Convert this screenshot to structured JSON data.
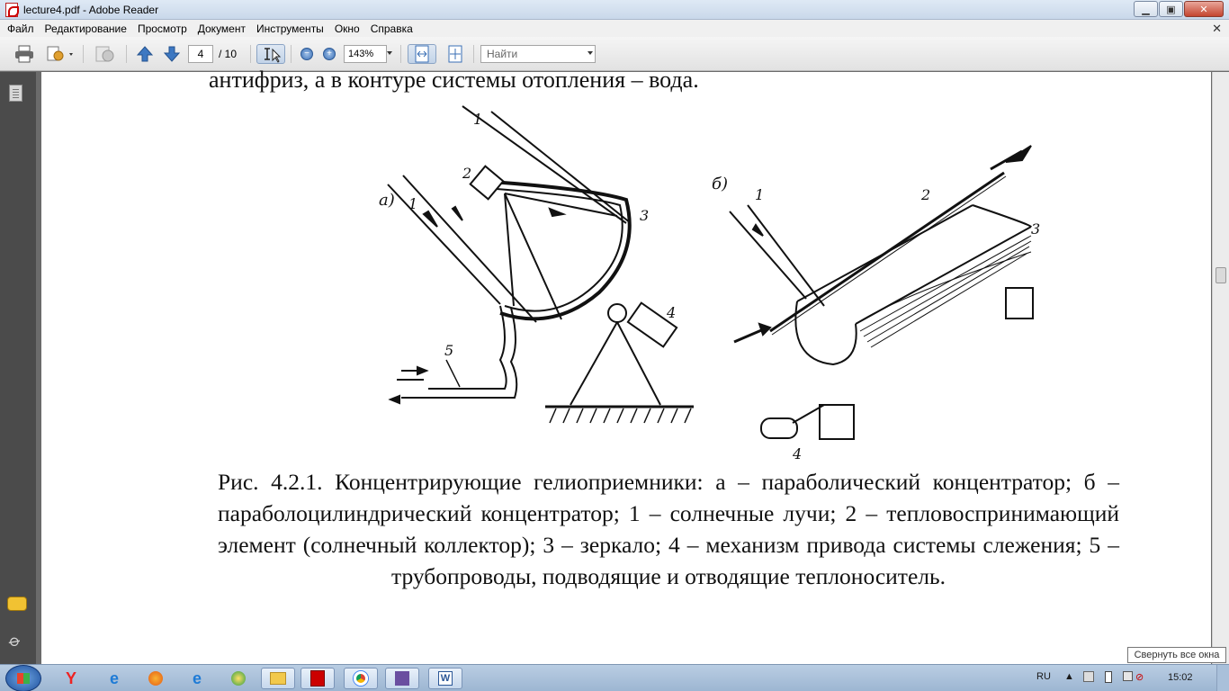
{
  "window": {
    "title": "lecture4.pdf - Adobe Reader",
    "controls": {
      "minimize": "▁",
      "maximize": "▣",
      "close": "✕"
    }
  },
  "menu": {
    "items": [
      "Файл",
      "Редактирование",
      "Просмотр",
      "Документ",
      "Инструменты",
      "Окно",
      "Справка"
    ],
    "close_glyph": "✕"
  },
  "toolbar": {
    "page_current": "4",
    "page_total": "/ 10",
    "zoom": "143%",
    "find_placeholder": "Найти"
  },
  "document": {
    "top_line": "антифриз, а в контуре системы отопления – вода.",
    "caption": "Рис. 4.2.1. Концентрирующие гелиоприемники: а – параболический концентратор; б – параболоцилиндрический концентратор; 1 – солнечные лучи; 2 – тепловоспринимающий элемент (солнечный коллектор); 3 – зеркало; 4 – механизм привода системы слежения; 5 – трубопроводы, подводящие и отводящие теплоноситель.",
    "figure_labels": {
      "a": "а)",
      "b": "б)",
      "l1": "1",
      "l2": "2",
      "l3": "3",
      "l4": "4",
      "l5": "5",
      "m1": "1",
      "m2": "2",
      "m3": "3",
      "m4": "4"
    }
  },
  "tooltip": "Свернуть все окна",
  "taskbar": {
    "lang": "RU",
    "time": "15:02"
  },
  "colors": {
    "titlebar": "#c9d8ea",
    "taskbar": "#9db6d2",
    "nav_pane": "#4b4b4b",
    "doc_bg": "#6b6b6b"
  }
}
